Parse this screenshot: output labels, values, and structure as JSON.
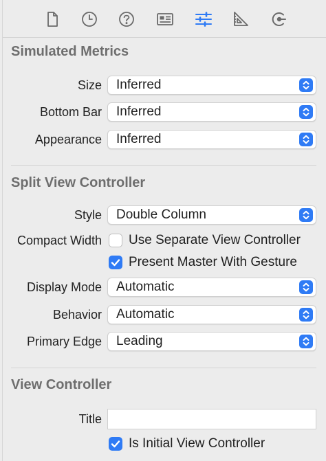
{
  "toolbar": {
    "tabs": [
      {
        "icon": "file-icon",
        "selected": false
      },
      {
        "icon": "history-clock-icon",
        "selected": false
      },
      {
        "icon": "help-icon",
        "selected": false
      },
      {
        "icon": "identity-card-icon",
        "selected": false
      },
      {
        "icon": "attributes-sliders-icon",
        "selected": true
      },
      {
        "icon": "size-ruler-icon",
        "selected": false
      },
      {
        "icon": "connections-icon",
        "selected": false
      }
    ],
    "selected_color": "#2f7bf5"
  },
  "simulated_metrics": {
    "title": "Simulated Metrics",
    "size_label": "Size",
    "size_value": "Inferred",
    "bottom_bar_label": "Bottom Bar",
    "bottom_bar_value": "Inferred",
    "appearance_label": "Appearance",
    "appearance_value": "Inferred"
  },
  "split_view_controller": {
    "title": "Split View Controller",
    "style_label": "Style",
    "style_value": "Double Column",
    "compact_width_label": "Compact Width",
    "use_separate_label": "Use Separate View Controller",
    "use_separate_checked": false,
    "present_master_label": "Present Master With Gesture",
    "present_master_checked": true,
    "display_mode_label": "Display Mode",
    "display_mode_value": "Automatic",
    "behavior_label": "Behavior",
    "behavior_value": "Automatic",
    "primary_edge_label": "Primary Edge",
    "primary_edge_value": "Leading"
  },
  "view_controller": {
    "title": "View Controller",
    "title_label": "Title",
    "title_value": "",
    "is_initial_label": "Is Initial View Controller",
    "is_initial_checked": true
  }
}
